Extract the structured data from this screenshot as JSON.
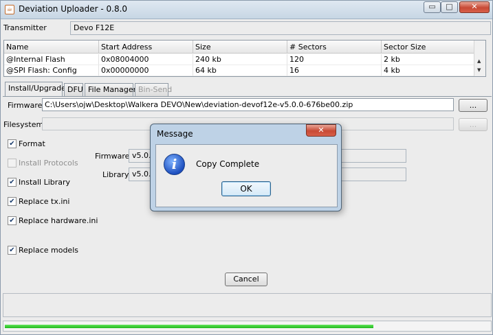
{
  "window": {
    "title": "Deviation Uploader - 0.8.0",
    "controls": {
      "minimize": "▭",
      "maximize": "□",
      "close": "✕"
    }
  },
  "transmitter": {
    "label": "Transmitter",
    "value": "Devo F12E"
  },
  "memory_table": {
    "columns": [
      "Name",
      "Start Address",
      "Size",
      "# Sectors",
      "Sector Size"
    ],
    "rows": [
      [
        "@Internal Flash",
        "0x08004000",
        "240 kb",
        "120",
        "2 kb"
      ],
      [
        "@SPI Flash: Config",
        "0x00000000",
        "64 kb",
        "16",
        "4 kb"
      ]
    ]
  },
  "tabs": [
    {
      "label": "Install/Upgrade",
      "active": true
    },
    {
      "label": "DFU"
    },
    {
      "label": "File Manager"
    },
    {
      "label": "Bin-Send",
      "disabled": true
    }
  ],
  "install": {
    "firmware_label": "Firmware",
    "firmware_path": "C:\\Users\\ojw\\Desktop\\Walkera DEVO\\New\\deviation-devof12e-v5.0.0-676be00.zip",
    "filesystem_label": "Filesystem",
    "filesystem_path": "",
    "browse_label": "...",
    "options": [
      {
        "label": "Format",
        "checked": true
      },
      {
        "label": "Install Protocols",
        "checked": false,
        "disabled": true
      },
      {
        "label": "Install Library",
        "checked": true
      },
      {
        "label": "Replace tx.ini",
        "checked": true
      },
      {
        "label": "Replace hardware.ini",
        "checked": true
      },
      {
        "label": "Replace models",
        "checked": true
      }
    ],
    "version_firmware_label": "Firmware",
    "version_firmware_value": "v5.0.0",
    "version_library_label": "Library",
    "version_library_value": "v5.0.0",
    "cancel_label": "Cancel"
  },
  "progress": {
    "fraction": 0.76,
    "color": "#2ec52a"
  },
  "dialog": {
    "title": "Message",
    "message": "Copy Complete",
    "ok_label": "OK",
    "icon": "info-icon",
    "close": "✕"
  },
  "colors": {
    "window_bg": "#ececec",
    "dialog_frame": "#bed2e6",
    "close_red": "#c84a35"
  }
}
